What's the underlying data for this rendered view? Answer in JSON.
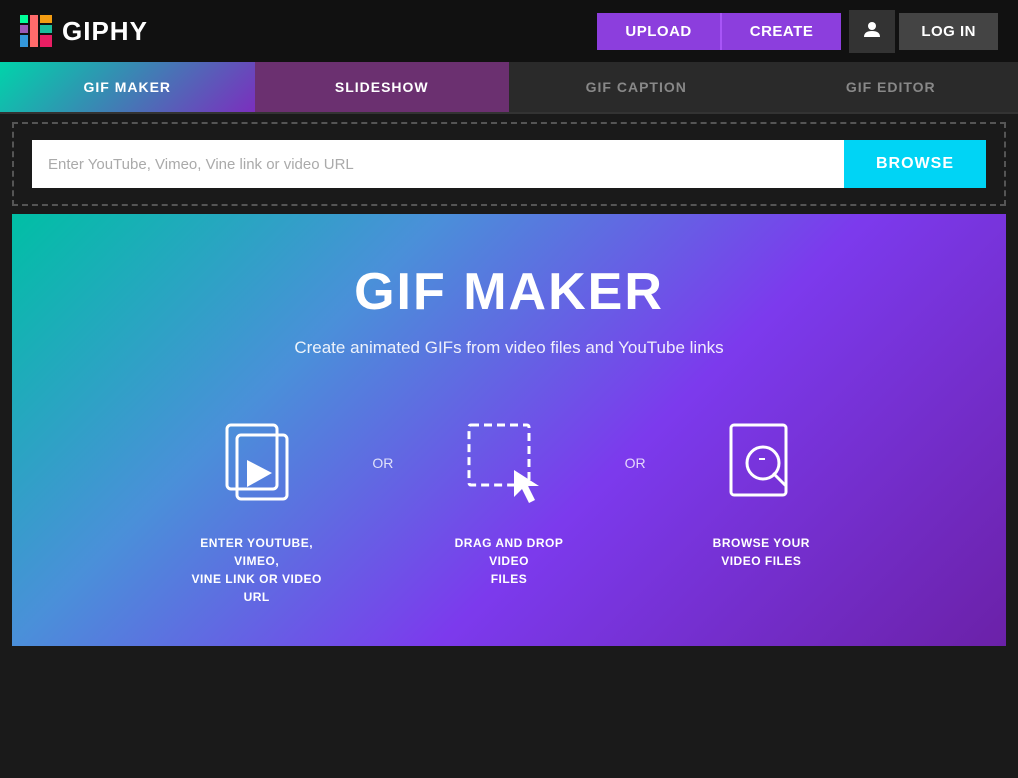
{
  "header": {
    "logo_text": "GIPHY",
    "upload_label": "UPLOAD",
    "create_label": "CREATE",
    "login_label": "LOG IN"
  },
  "tabs": [
    {
      "id": "gif-maker",
      "label": "GIF MAKER",
      "active": true
    },
    {
      "id": "slideshow",
      "label": "SLIDESHOW",
      "active": false
    },
    {
      "id": "gif-caption",
      "label": "GIF CAPTION",
      "active": false
    },
    {
      "id": "gif-editor",
      "label": "GIF EDITOR",
      "active": false
    }
  ],
  "url_section": {
    "placeholder": "Enter YouTube, Vimeo, Vine link or video URL",
    "browse_label": "BROWSE"
  },
  "main": {
    "title": "GIF MAKER",
    "subtitle": "Create animated GIFs from video files and YouTube links",
    "icons": [
      {
        "id": "enter-url",
        "label": "ENTER YOUTUBE, VIMEO,\nVINE LINK OR VIDEO URL"
      },
      {
        "id": "drag-drop",
        "label": "DRAG AND DROP VIDEO\nFILES"
      },
      {
        "id": "browse-files",
        "label": "BROWSE YOUR VIDEO FILES"
      }
    ],
    "or_label": "OR"
  },
  "colors": {
    "purple_accent": "#8c3edd",
    "cyan_accent": "#00d4f5",
    "tab_active_gradient_start": "#00d4aa",
    "tab_active_gradient_end": "#7b2fbe"
  }
}
